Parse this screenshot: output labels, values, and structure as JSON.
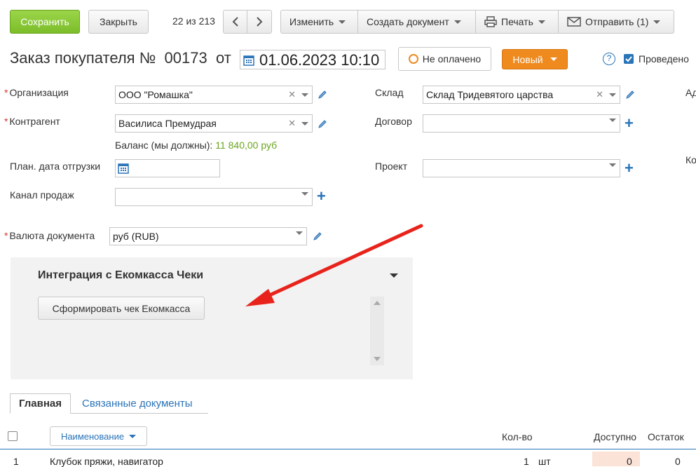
{
  "toolbar": {
    "save_label": "Сохранить",
    "close_label": "Закрыть",
    "counter": "22 из 213",
    "edit_label": "Изменить",
    "create_doc_label": "Создать документ",
    "print_label": "Печать",
    "send_label": "Отправить (1)"
  },
  "header": {
    "title": "Заказ покупателя №",
    "number": "00173",
    "from_label": "от",
    "date": "01.06.2023 10:10",
    "payment_status": "Не оплачено",
    "state": "Новый",
    "help": "?",
    "posted_label": "Проведено"
  },
  "form": {
    "organization": {
      "label": "Организация",
      "value": "ООО \"Ромашка\""
    },
    "counterparty": {
      "label": "Контрагент",
      "value": "Василиса Премудрая"
    },
    "balance_label": "Баланс (мы должны):",
    "balance_value": "11 840,00 руб",
    "ship_date_label": "План. дата отгрузки",
    "sales_channel_label": "Канал продаж",
    "currency": {
      "label": "Валюта документа",
      "value": "руб (RUB)"
    },
    "warehouse": {
      "label": "Склад",
      "value": "Склад Тридевятого царства"
    },
    "contract_label": "Договор",
    "project_label": "Проект",
    "edge_label_1": "Ад",
    "edge_label_2": "Ко"
  },
  "integration": {
    "title": "Интеграция с Екомкасса Чеки",
    "button_label": "Сформировать чек Екомкасса"
  },
  "tabs": {
    "main": "Главная",
    "related": "Связанные документы"
  },
  "table": {
    "name_header": "Наименование",
    "qty_header": "Кол-во",
    "available_header": "Доступно",
    "remain_header": "Остаток",
    "rows": [
      {
        "num": "1",
        "name": "Клубок пряжи, навигатор",
        "qty": "1",
        "unit": "шт",
        "available": "0",
        "remain": "0"
      }
    ]
  },
  "colors": {
    "accent_green": "#7cbd2a",
    "state_orange": "#ee8a1e",
    "link_blue": "#2a74b8",
    "arrow_red": "#e8231b",
    "balance_green": "#6aa51f"
  }
}
